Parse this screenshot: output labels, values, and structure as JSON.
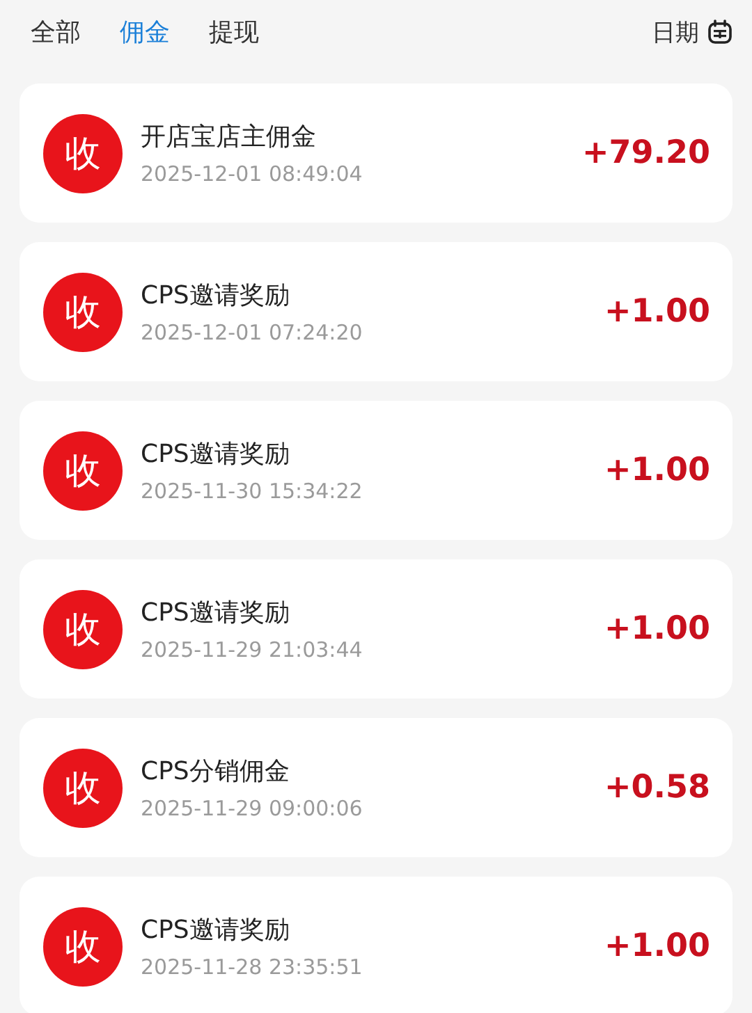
{
  "tabs": [
    {
      "label": "全部",
      "selected": false
    },
    {
      "label": "佣金",
      "selected": true
    },
    {
      "label": "提现",
      "selected": false
    }
  ],
  "date_filter": {
    "label": "日期"
  },
  "records": [
    {
      "badge": "收",
      "title": "开店宝店主佣金",
      "time": "2025-12-01 08:49:04",
      "amount": "+79.20"
    },
    {
      "badge": "收",
      "title": "CPS邀请奖励",
      "time": "2025-12-01 07:24:20",
      "amount": "+1.00"
    },
    {
      "badge": "收",
      "title": "CPS邀请奖励",
      "time": "2025-11-30 15:34:22",
      "amount": "+1.00"
    },
    {
      "badge": "收",
      "title": "CPS邀请奖励",
      "time": "2025-11-29 21:03:44",
      "amount": "+1.00"
    },
    {
      "badge": "收",
      "title": "CPS分销佣金",
      "time": "2025-11-29 09:00:06",
      "amount": "+0.58"
    },
    {
      "badge": "收",
      "title": "CPS邀请奖励",
      "time": "2025-11-28 23:35:51",
      "amount": "+1.00"
    }
  ]
}
